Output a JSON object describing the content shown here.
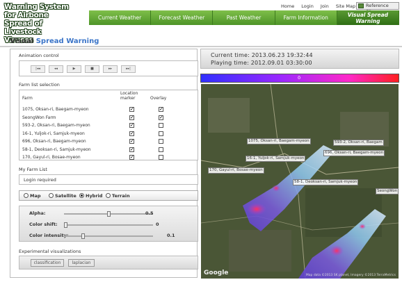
{
  "header": {
    "logo_text": "Warning System for Airbone Spread of Livestock Viruses",
    "top_links": [
      "Home",
      "Login",
      "Join",
      "Site Map"
    ],
    "reference_label": "Reference Site"
  },
  "nav": [
    "Current Weather",
    "Forecast Weather",
    "Past Weather",
    "Farm Information",
    "Visual Spread Warning"
  ],
  "page_title": {
    "part1": "Visual",
    "part2": "Spread Warning"
  },
  "animation": {
    "label": "Animation control",
    "buttons": [
      "|◂◂",
      "◂◂",
      "▶",
      "■",
      "▸▸",
      "▸▸|"
    ]
  },
  "farms": {
    "label": "Farm list selection",
    "col_farm": "Farm",
    "col_location": "Location marker",
    "col_overlay": "Overlay",
    "rows": [
      {
        "name": "1075, Oksan-ri, Baegam-myeon",
        "location": true,
        "overlay": true
      },
      {
        "name": "SeongWon Farm",
        "location": true,
        "overlay": true
      },
      {
        "name": "593-2, Oksan-ri, Baegam-myeon",
        "location": true,
        "overlay": false
      },
      {
        "name": "16-1, Yuljok-ri, Samjuk-myeon",
        "location": true,
        "overlay": false
      },
      {
        "name": "696, Oksan-ri, Baegam-myeon",
        "location": true,
        "overlay": false
      },
      {
        "name": "58-1, Deoksan-ri, Samjuk-myeon",
        "location": true,
        "overlay": false
      },
      {
        "name": "170, Gayul-ri, Bosae-myeon",
        "location": true,
        "overlay": false
      }
    ]
  },
  "my_farm": {
    "label": "My Farm List",
    "message": "Login required"
  },
  "map_type": {
    "options": [
      "Map",
      "Satellite",
      "Hybrid",
      "Terrain"
    ],
    "selected": "Hybrid"
  },
  "sliders": [
    {
      "label": "Alpha:",
      "value": "0.5",
      "fraction": 0.5
    },
    {
      "label": "Color shift:",
      "value": "0",
      "fraction": 0.0
    },
    {
      "label": "Color intensity:",
      "value": "0.1",
      "fraction": 0.2
    }
  ],
  "experimental": {
    "label": "Experimental visualizations",
    "buttons": [
      "classification",
      "laplacian"
    ]
  },
  "time": {
    "current": "Current time:  2013.06.23  19:32:44",
    "playing": "Playing time:  2012.09.01  03:30:00"
  },
  "legend_value": "0",
  "map_labels": [
    "1075, Oksan-ri, Baegam-myeon",
    "593-2, Oksan-ri, Baegam",
    "696, Oksan-ri, Baegam-myeon",
    "16-1, Yuljok-ri, Samjuk-myeon",
    "170, Gayul-ri, Bosae-myeon",
    "58-1, Deoksan-ri, Samjuk-myeon",
    "SeongWon"
  ],
  "map_brand": "Google",
  "map_copyright": "Map data ©2013 SK planet, Imagery ©2013 TerraMetrics",
  "colors": {
    "nav_green": "#5a9f2e",
    "accent_blue": "#3a74c8",
    "plume_low": "#3030ff",
    "plume_high": "#ff2020"
  }
}
